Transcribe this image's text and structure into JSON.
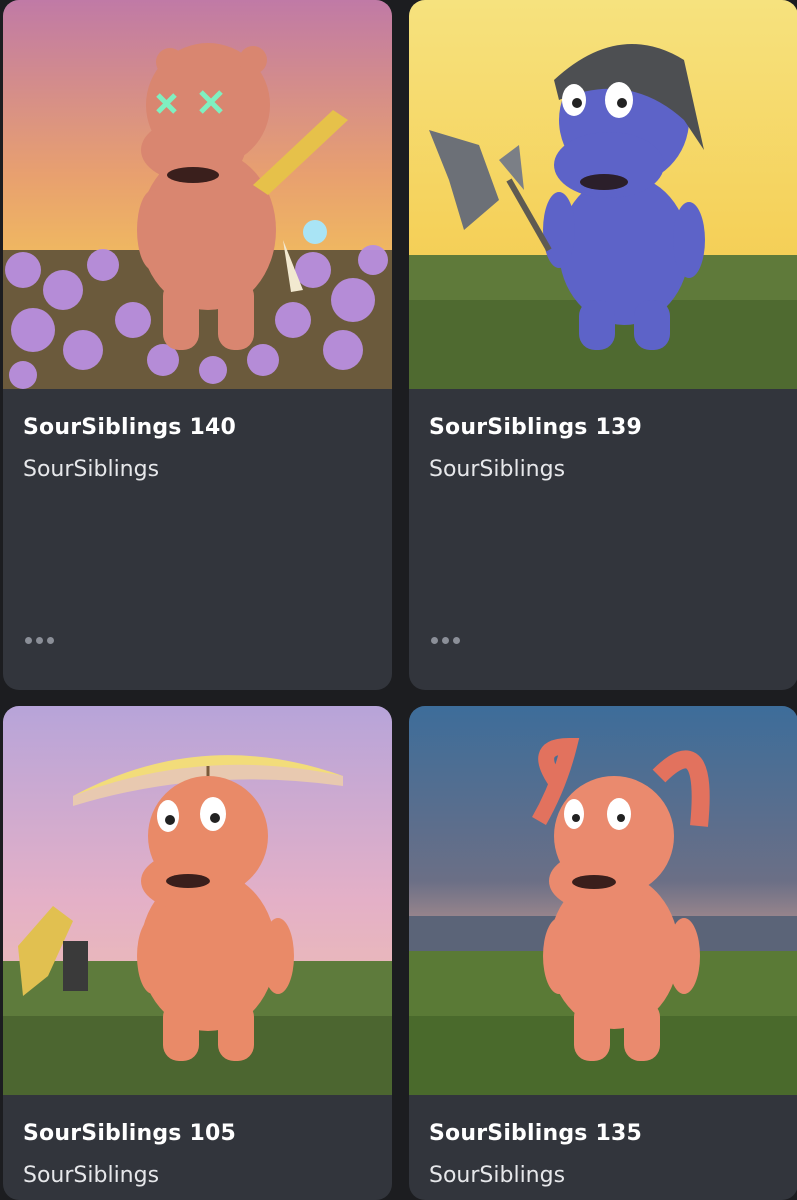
{
  "cards": [
    {
      "title": "SourSiblings 140",
      "collection": "SourSiblings",
      "image": "pink-bear-with-sword-in-flower-field",
      "more_icon": "more-horizontal-icon"
    },
    {
      "title": "SourSiblings 139",
      "collection": "SourSiblings",
      "image": "blue-bear-with-cap-and-axe-on-grass",
      "more_icon": "more-horizontal-icon"
    },
    {
      "title": "SourSiblings 105",
      "collection": "SourSiblings",
      "image": "pink-bear-with-umbrella-on-grass",
      "more_icon": "more-horizontal-icon"
    },
    {
      "title": "SourSiblings 135",
      "collection": "SourSiblings",
      "image": "pink-bear-with-ram-horns-on-grass",
      "more_icon": "more-horizontal-icon"
    }
  ],
  "colors": {
    "background": "#1c1d20",
    "card": "#32353c",
    "title": "#ffffff",
    "subtitle": "#e6e7ea",
    "dots": "#8b8f98"
  }
}
